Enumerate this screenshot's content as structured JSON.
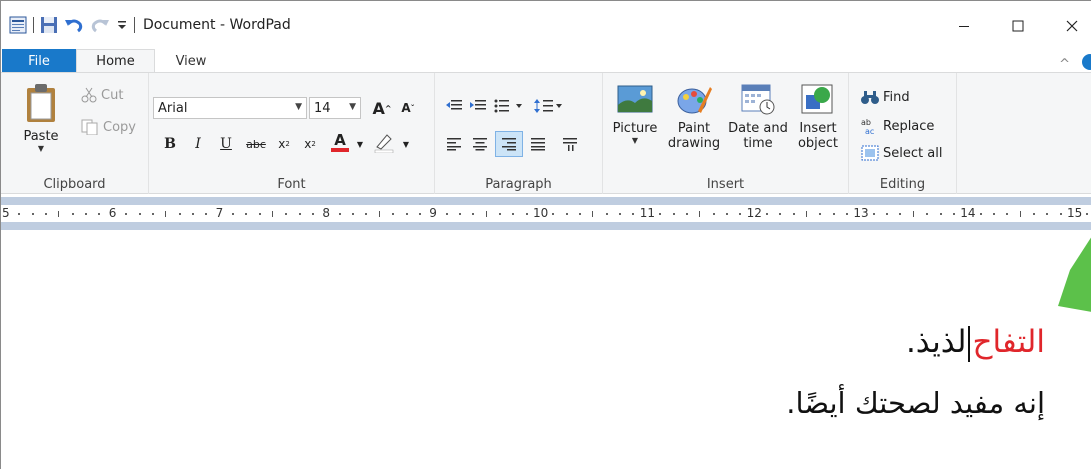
{
  "titlebar": {
    "title": "Document - WordPad",
    "minimize": "–",
    "maximize": "☐",
    "close": "✕"
  },
  "tabs": {
    "file": "File",
    "home": "Home",
    "view": "View",
    "collapse": "^"
  },
  "ribbon": {
    "clipboard": {
      "label": "Clipboard",
      "paste": "Paste",
      "cut": "Cut",
      "copy": "Copy"
    },
    "font": {
      "label": "Font",
      "family": "Arial",
      "size": "14"
    },
    "paragraph": {
      "label": "Paragraph"
    },
    "insert": {
      "label": "Insert",
      "picture": "Picture",
      "paint_line1": "Paint",
      "paint_line2": "drawing",
      "datetime_line1": "Date and",
      "datetime_line2": "time",
      "object_line1": "Insert",
      "object_line2": "object"
    },
    "editing": {
      "label": "Editing",
      "find": "Find",
      "replace": "Replace",
      "select_all": "Select all"
    }
  },
  "ruler": {
    "numbers": [
      "5",
      "6",
      "7",
      "8",
      "9",
      "10",
      "11",
      "12",
      "13",
      "14",
      "15"
    ]
  },
  "document": {
    "line1_highlight": "التفاح",
    "line1_rest": "لذيذ.",
    "line2": "إنه مفيد لصحتك أيضًا."
  },
  "colors": {
    "file_tab": "#1979ca",
    "ribbon_bg": "#f5f6f7",
    "ruler_band": "#bfcde0",
    "highlight_text": "#e0262b",
    "annotation_triangle": "#5cc14a"
  }
}
